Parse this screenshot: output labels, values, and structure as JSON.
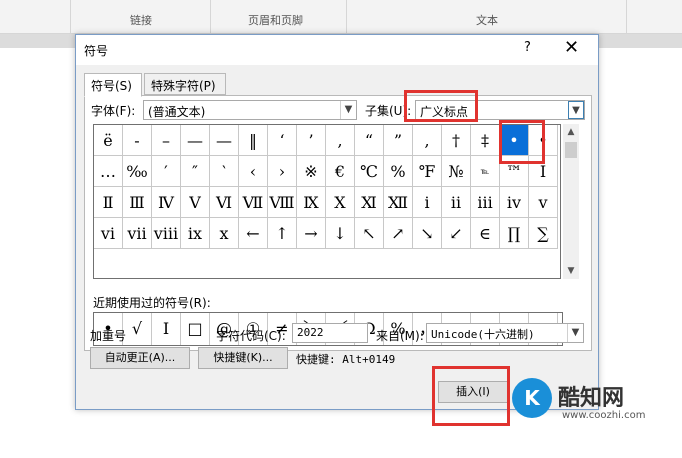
{
  "ribbon": {
    "groups": [
      "链接",
      "页眉和页脚",
      "文本"
    ]
  },
  "dialog": {
    "title": "符号",
    "help_label": "?",
    "close_label": "✕",
    "tabs": [
      "符号(S)",
      "特殊字符(P)"
    ],
    "font_label": "字体(F):",
    "font_value": "(普通文本)",
    "subset_label": "子集(U):",
    "subset_value": "广义标点",
    "symbols": [
      [
        "ë",
        "-",
        "–",
        "—",
        "—",
        "‖",
        "‘",
        "’",
        ",",
        "“",
        "”",
        ",",
        "†",
        "‡",
        "•",
        "•"
      ],
      [
        "…",
        "‰",
        "′",
        "″",
        "‵",
        "‹",
        "›",
        "※",
        "€",
        "℃",
        "%",
        "℉",
        "№",
        "℡",
        "™",
        "Ⅰ"
      ],
      [
        "Ⅱ",
        "Ⅲ",
        "Ⅳ",
        "Ⅴ",
        "Ⅵ",
        "Ⅶ",
        "Ⅷ",
        "Ⅸ",
        "Ⅹ",
        "Ⅺ",
        "Ⅻ",
        "ⅰ",
        "ⅱ",
        "ⅲ",
        "ⅳ",
        "ⅴ"
      ],
      [
        "ⅵ",
        "ⅶ",
        "ⅷ",
        "ⅸ",
        "ⅹ",
        "←",
        "↑",
        "→",
        "↓",
        "↖",
        "↗",
        "↘",
        "↙",
        "∈",
        "∏",
        "∑"
      ]
    ],
    "selected_symbol": "•",
    "recent_label": "近期使用过的符号(R):",
    "recent_symbols": [
      "•",
      "√",
      "Ⅰ",
      "□",
      "@",
      "①",
      "≠",
      "〕",
      "〔",
      "Ω",
      "%",
      "，",
      "。",
      "、",
      "；",
      "："
    ],
    "char_name": "加重号",
    "char_code_label": "字符代码(C):",
    "char_code_value": "2022",
    "from_label": "来自(M):",
    "from_value": "Unicode(十六进制)",
    "autocorrect_label": "自动更正(A)...",
    "shortcut_key_label": "快捷键(K)...",
    "shortcut_text": "快捷键: Alt+0149",
    "insert_label": "插入(I)"
  },
  "watermark": {
    "name": "酷知网",
    "url": "www.coozhi.com",
    "logo_text": "K"
  },
  "colors": {
    "selected_bg": "#0a6fd8",
    "highlight": "#e0332f",
    "accent_border": "#3c7fb1"
  }
}
